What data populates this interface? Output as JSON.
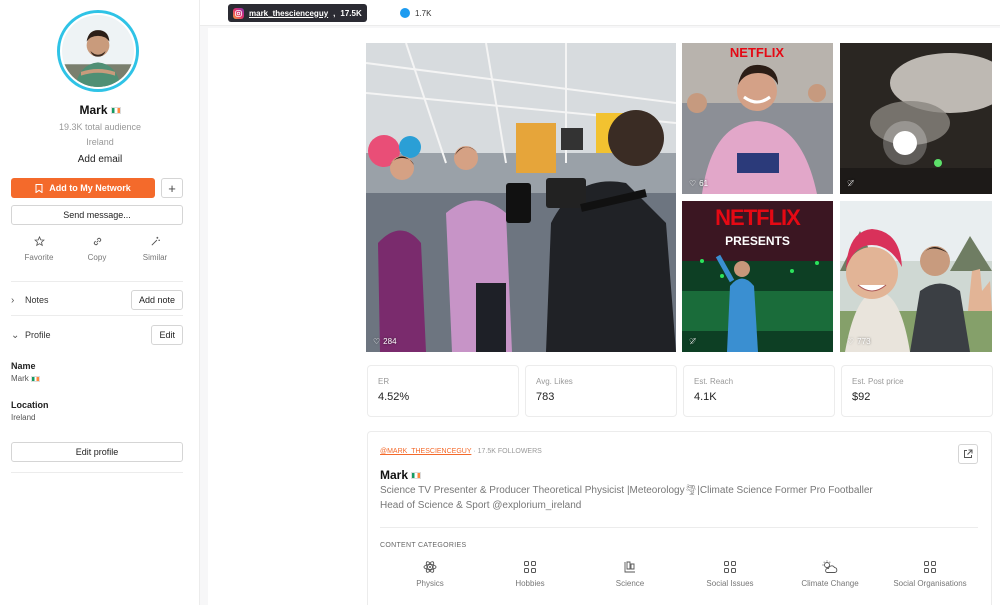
{
  "profile": {
    "name": "Mark",
    "total_audience": "19.3K total audience",
    "country": "Ireland",
    "add_email": "Add email"
  },
  "buttons": {
    "add_network": "Add to My Network",
    "plus": "+",
    "send_message": "Send message...",
    "add_note": "Add note",
    "edit": "Edit",
    "edit_profile": "Edit profile"
  },
  "actions": [
    {
      "label": "Favorite",
      "icon": "star-icon"
    },
    {
      "label": "Copy",
      "icon": "link-icon"
    },
    {
      "label": "Similar",
      "icon": "magic-wand-icon"
    }
  ],
  "sections": {
    "notes": "Notes",
    "profile": "Profile"
  },
  "fields": {
    "name_label": "Name",
    "name_value": "Mark",
    "location_label": "Location",
    "location_value": "Ireland"
  },
  "topbar": {
    "instagram_handle": "mark_thescienceguy",
    "instagram_followers": "17.5K",
    "twitter_followers": "1.7K"
  },
  "posts": [
    {
      "likes": "284",
      "likes_hidden": false
    },
    {
      "likes": "61",
      "likes_hidden": false
    },
    {
      "likes": "",
      "likes_hidden": true
    },
    {
      "likes": "",
      "likes_hidden": true,
      "overlay_title": "NETFLIX",
      "overlay_subtitle": "PRESENTS"
    },
    {
      "likes": "773",
      "likes_hidden": false
    }
  ],
  "stats": [
    {
      "label": "ER",
      "value": "4.52%"
    },
    {
      "label": "Avg. Likes",
      "value": "783"
    },
    {
      "label": "Est. Reach",
      "value": "4.1K"
    },
    {
      "label": "Est. Post price",
      "value": "$92"
    }
  ],
  "bio_card": {
    "handle": "@mark_thescienceguy",
    "separator": " · ",
    "followers": "17.5K FOLLOWERS",
    "name": "Mark",
    "bio_line1": "Science TV Presenter & Producer Theoretical Physicist |Meteorology🌪|Climate Science Former Pro Footballer",
    "bio_line2": "Head of Science & Sport @explorium_ireland",
    "categories_title": "CONTENT CATEGORIES"
  },
  "categories": [
    {
      "label": "Physics",
      "icon": "atom-icon"
    },
    {
      "label": "Hobbies",
      "icon": "grid-icon"
    },
    {
      "label": "Science",
      "icon": "flask-icon"
    },
    {
      "label": "Social Issues",
      "icon": "grid-icon"
    },
    {
      "label": "Climate Change",
      "icon": "cloud-sun-icon"
    },
    {
      "label": "Social Organisations",
      "icon": "grid-icon"
    }
  ],
  "colors": {
    "accent": "#f46a2b",
    "avatar_ring": "#2fc3e6",
    "instagram_pill": "#2b2b33",
    "twitter": "#1d9bf0",
    "netflix_red": "#e50914"
  }
}
